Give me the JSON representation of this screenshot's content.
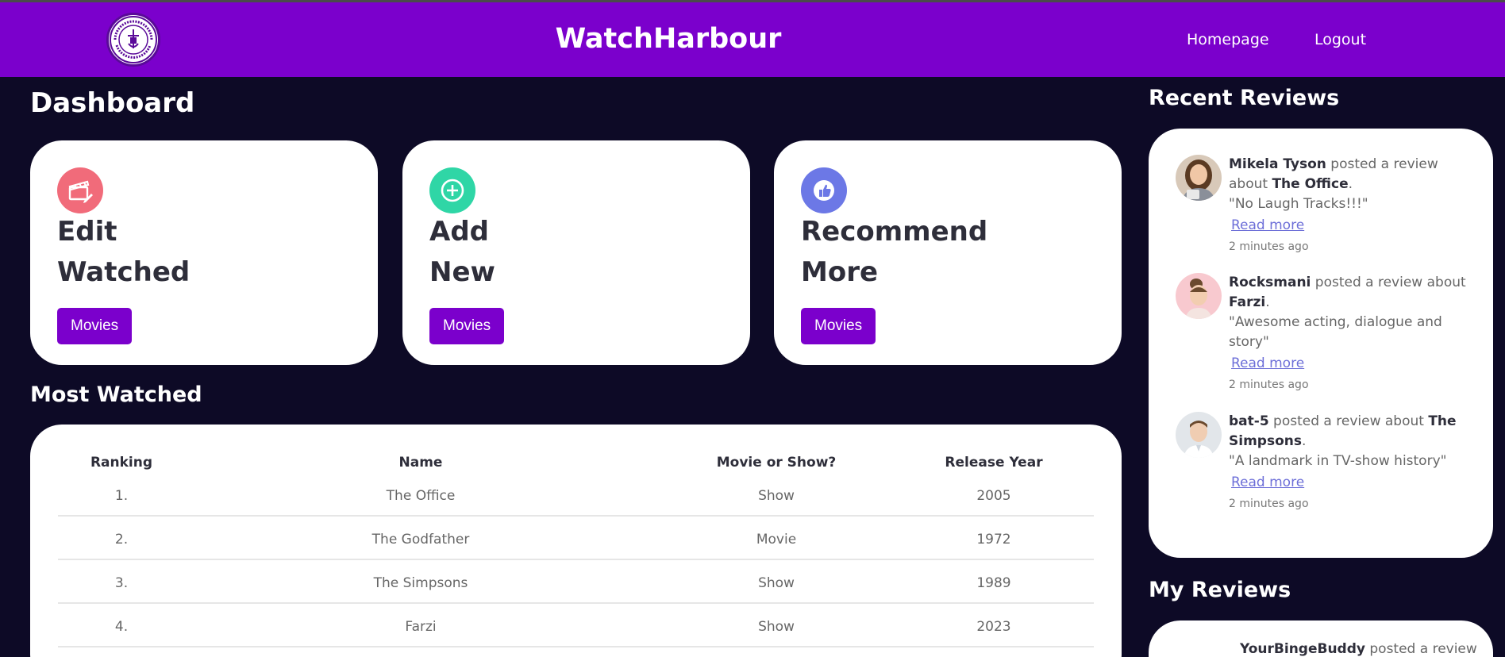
{
  "header": {
    "brand": "WatchHarbour",
    "logo_top_text": "WATCHHARBOUR",
    "logo_bottom_text": "YOUR BINGE DIARY",
    "nav": {
      "home": "Homepage",
      "logout": "Logout"
    },
    "color": "#7b00cc"
  },
  "dashboard": {
    "title": "Dashboard",
    "cards": [
      {
        "line1": "Edit",
        "line2": "Watched",
        "button": "Movies",
        "icon": "clapperboard-edit-icon",
        "icon_color": "#f16b7a"
      },
      {
        "line1": "Add",
        "line2": "New",
        "button": "Movies",
        "icon": "plus-circle-icon",
        "icon_color": "#2fd6a6"
      },
      {
        "line1": "Recommend",
        "line2": "More",
        "button": "Movies",
        "icon": "thumbs-up-icon",
        "icon_color": "#6c78e6"
      }
    ]
  },
  "most_watched": {
    "title": "Most Watched",
    "columns": [
      "Ranking",
      "Name",
      "Movie or Show?",
      "Release Year"
    ],
    "rows": [
      [
        "1.",
        "The Office",
        "Show",
        "2005"
      ],
      [
        "2.",
        "The Godfather",
        "Movie",
        "1972"
      ],
      [
        "3.",
        "The Simpsons",
        "Show",
        "1989"
      ],
      [
        "4.",
        "Farzi",
        "Show",
        "2023"
      ]
    ]
  },
  "recent_reviews": {
    "title": "Recent Reviews",
    "items": [
      {
        "user": "Mikela Tyson",
        "verb": " posted a review about ",
        "title": "The Office",
        "quote": "\"No Laugh Tracks!!!\"",
        "read_more": "Read more",
        "ago": "2 minutes ago"
      },
      {
        "user": "Rocksmani",
        "verb": " posted a review about ",
        "title": "Farzi",
        "quote": "\"Awesome acting, dialogue and story\"",
        "read_more": "Read more",
        "ago": "2 minutes ago"
      },
      {
        "user": "bat-5",
        "verb": " posted a review about ",
        "title": "The Simpsons",
        "quote": "\"A landmark in TV-show history\"",
        "read_more": "Read more",
        "ago": "2 minutes ago"
      }
    ]
  },
  "my_reviews": {
    "title": "My Reviews",
    "first_user": "YourBingeBuddy",
    "first_verb": " posted a review"
  }
}
